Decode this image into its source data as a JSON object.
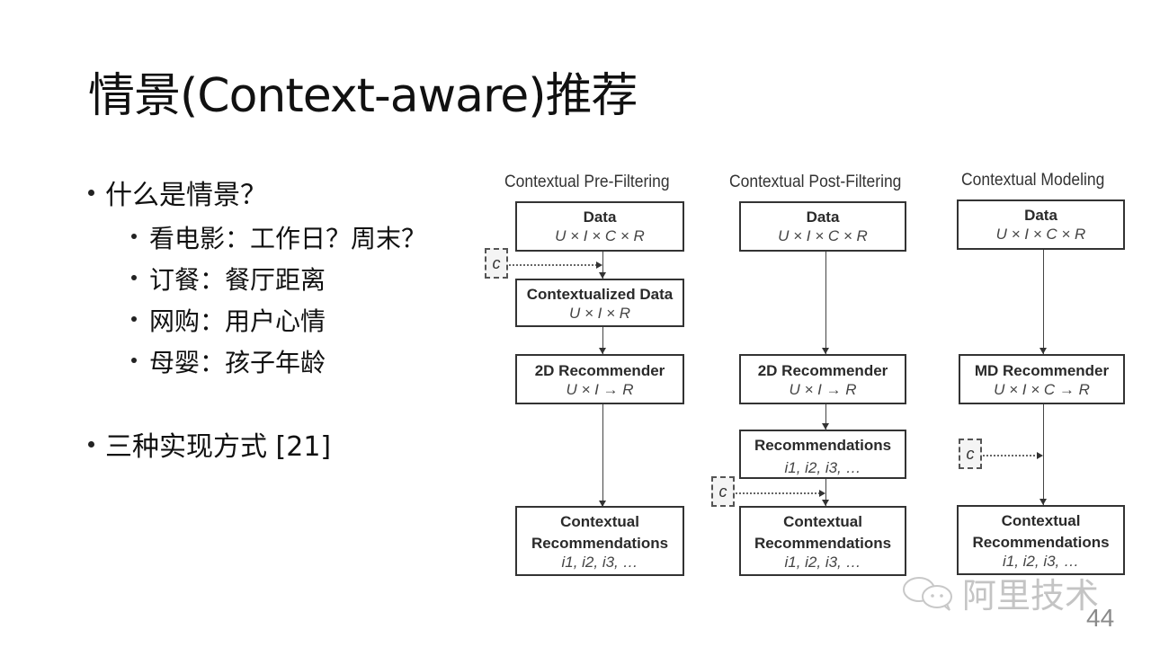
{
  "slide": {
    "title": "情景(Context-aware)推荐",
    "page_number": "44",
    "watermark": "阿里技术"
  },
  "bullets": [
    {
      "text": "什么是情景？",
      "children": [
        "看电影：工作日？周末？",
        "订餐：餐厅距离",
        "网购：用户心情",
        "母婴：孩子年龄"
      ]
    },
    {
      "text": "三种实现方式 [21]",
      "children": []
    }
  ],
  "diagram": {
    "columns": [
      {
        "title": "Contextual Pre-Filtering",
        "boxes": [
          {
            "heading": "Data",
            "formula": "U × I × C × R"
          },
          {
            "heading": "Contextualized Data",
            "formula": "U × I × R"
          },
          {
            "heading": "2D Recommender",
            "formula": "U × I → R"
          },
          {
            "heading": "Contextual",
            "heading2": "Recommendations",
            "formula": "i1, i2, i3, …"
          }
        ],
        "context_label": "c"
      },
      {
        "title": "Contextual Post-Filtering",
        "boxes": [
          {
            "heading": "Data",
            "formula": "U × I × C × R"
          },
          {
            "heading": "2D Recommender",
            "formula": "U × I → R"
          },
          {
            "heading": "Recommendations",
            "formula": "i1, i2, i3, …"
          },
          {
            "heading": "Contextual",
            "heading2": "Recommendations",
            "formula": "i1, i2, i3, …"
          }
        ],
        "context_label": "c"
      },
      {
        "title": "Contextual Modeling",
        "boxes": [
          {
            "heading": "Data",
            "formula": "U × I × C × R"
          },
          {
            "heading": "MD Recommender",
            "formula": "U × I × C → R"
          },
          {
            "heading": "Contextual",
            "heading2": "Recommendations",
            "formula": "i1, i2, i3, …"
          }
        ],
        "context_label": "c"
      }
    ]
  }
}
